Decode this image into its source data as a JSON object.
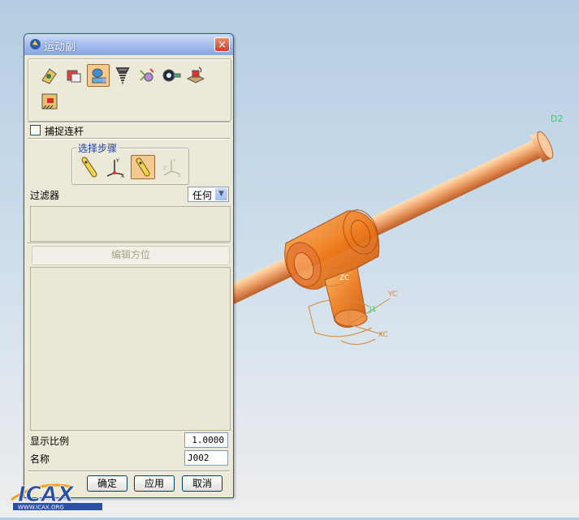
{
  "dialog": {
    "title": "运动副",
    "close_label": "×",
    "tools": [
      "revolute-joint-icon",
      "slider-joint-icon",
      "cylindrical-joint-icon",
      "screw-joint-icon",
      "universal-joint-icon",
      "spherical-joint-icon",
      "planar-joint-icon",
      "fixed-joint-icon"
    ],
    "active_tool": "cylindrical-joint-icon",
    "snap_link": {
      "label": "捕捉连杆",
      "checked": false
    },
    "steps": {
      "legend": "选择步骤",
      "items": [
        "select-link-step-icon",
        "origin-orient-step-icon",
        "base-link-step-icon",
        "base-orient-step-icon"
      ],
      "active": "base-link-step-icon"
    },
    "filter": {
      "label": "过滤器",
      "value": "任何"
    },
    "edit_orientation_label": "编辑方位",
    "display_scale": {
      "label": "显示比例",
      "value": "1.0000"
    },
    "name": {
      "label": "名称",
      "value": "J002"
    },
    "buttons": {
      "ok": "确定",
      "apply": "应用",
      "cancel": "取消"
    }
  },
  "viewport": {
    "labels": {
      "link_label": "D2",
      "zc": "ZC",
      "yc": "YC",
      "xc": "XC",
      "joint_label": "J1"
    },
    "colors": {
      "model": "#e8742a",
      "axis": "#d28a3c",
      "label_green": "#33cc66",
      "background_top": "#b5cde2"
    }
  },
  "watermark": {
    "text": "ICAX",
    "url": "WWW.ICAX.ORG"
  }
}
